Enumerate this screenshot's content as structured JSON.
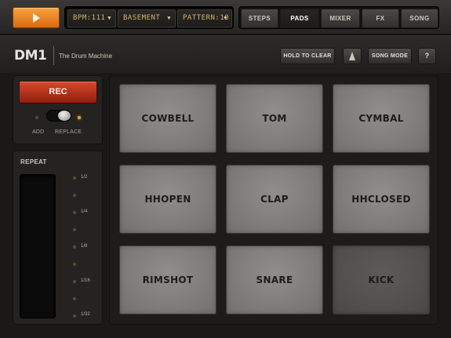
{
  "topbar": {
    "play_icon": "play-icon",
    "bpm_label": "BPM:111",
    "kit_label": "BASEMENT",
    "pattern_label": "PATTERN:10",
    "caret": "▼",
    "tabs": [
      {
        "label": "STEPS",
        "active": false
      },
      {
        "label": "PADS",
        "active": true
      },
      {
        "label": "MIXER",
        "active": false
      },
      {
        "label": "FX",
        "active": false
      },
      {
        "label": "SONG",
        "active": false
      }
    ]
  },
  "header": {
    "logo": "DM1",
    "subtitle": "The Drum Machine",
    "hold_to_clear": "HOLD TO CLEAR",
    "metronome_icon": "metronome-icon",
    "song_mode": "SONG MODE",
    "help": "?"
  },
  "record": {
    "rec_label": "REC",
    "add_label": "ADD",
    "replace_label": "REPLACE",
    "mode": "REPLACE"
  },
  "repeat": {
    "title": "REPEAT",
    "ticks": [
      "1/2",
      "1/4",
      "1/8",
      "1/16",
      "1/32"
    ]
  },
  "pads": [
    {
      "label": "COWBELL",
      "dim": false
    },
    {
      "label": "TOM",
      "dim": false
    },
    {
      "label": "CYMBAL",
      "dim": false
    },
    {
      "label": "HHOPEN",
      "dim": false
    },
    {
      "label": "CLAP",
      "dim": false
    },
    {
      "label": "HHCLOSED",
      "dim": false
    },
    {
      "label": "RIMSHOT",
      "dim": false
    },
    {
      "label": "SNARE",
      "dim": false
    },
    {
      "label": "KICK",
      "dim": true
    }
  ],
  "colors": {
    "accent_orange": "#e8861f",
    "rec_red": "#c23a1f",
    "lcd_text": "#d3b46a",
    "pad_gray": "#838281"
  }
}
